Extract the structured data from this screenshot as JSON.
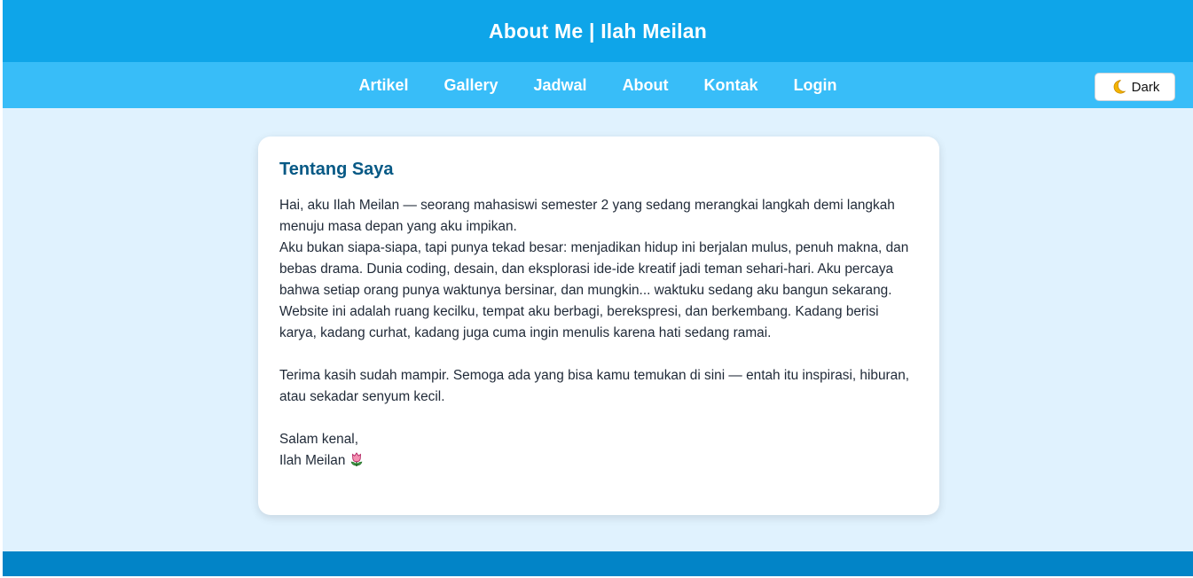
{
  "header": {
    "title": "About Me | Ilah Meilan"
  },
  "nav": {
    "items": [
      {
        "label": "Artikel"
      },
      {
        "label": "Gallery"
      },
      {
        "label": "Jadwal"
      },
      {
        "label": "About"
      },
      {
        "label": "Kontak"
      },
      {
        "label": "Login"
      }
    ],
    "dark_toggle": {
      "icon": "moon-icon",
      "label": "Dark"
    }
  },
  "about": {
    "heading": "Tentang Saya",
    "paragraph_1": "Hai, aku Ilah Meilan — seorang mahasiswi semester 2 yang sedang merangkai langkah demi langkah menuju masa depan yang aku impikan.",
    "paragraph_2": "Aku bukan siapa-siapa, tapi punya tekad besar: menjadikan hidup ini berjalan mulus, penuh makna, dan bebas drama. Dunia coding, desain, dan eksplorasi ide-ide kreatif jadi teman sehari-hari. Aku percaya bahwa setiap orang punya waktunya bersinar, dan mungkin... waktuku sedang aku bangun sekarang.",
    "paragraph_3": "Website ini adalah ruang kecilku, tempat aku berbagi, berekspresi, dan berkembang. Kadang berisi karya, kadang curhat, kadang juga cuma ingin menulis karena hati sedang ramai.",
    "paragraph_4": "Terima kasih sudah mampir. Semoga ada yang bisa kamu temukan di sini — entah itu inspirasi, hiburan, atau sekadar senyum kecil.",
    "closing": "Salam kenal,",
    "signature": "Ilah Meilan",
    "signature_icon": "tulip-icon"
  },
  "colors": {
    "header_bg": "#0ea5e9",
    "nav_bg": "#38bdf8",
    "page_bg": "#e0f2fe",
    "heading": "#075985",
    "footer_bg": "#0284c7"
  }
}
